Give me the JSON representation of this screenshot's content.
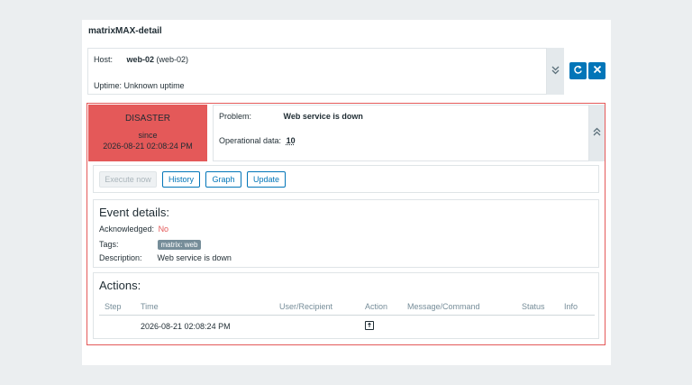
{
  "header": {
    "title": "matrixMAX-detail"
  },
  "host": {
    "host_label": "Host:",
    "host_name": "web-02",
    "host_visible": "(web-02)",
    "uptime_label": "Uptime:",
    "uptime_value": "Unknown uptime"
  },
  "icons": {
    "collapse": "double-chevron-down-icon",
    "expand": "double-chevron-up-icon",
    "refresh": "refresh-icon",
    "close": "close-icon",
    "action": "message-icon"
  },
  "severity": {
    "name": "DISASTER",
    "since_label": "since",
    "since_time": "2026-08-21 02:08:24 PM",
    "color": "#e45959"
  },
  "problem": {
    "problem_label": "Problem:",
    "problem_value": "Web service is down",
    "opdata_label": "Operational data:",
    "opdata_value": "10"
  },
  "buttons": {
    "execute": "Execute now",
    "history": "History",
    "graph": "Graph",
    "update": "Update"
  },
  "event": {
    "heading": "Event details:",
    "ack_label": "Acknowledged:",
    "ack_value": "No",
    "tags_label": "Tags:",
    "tag": "matrix: web",
    "desc_label": "Description:",
    "desc_value": "Web service is down"
  },
  "actions": {
    "heading": "Actions:",
    "columns": [
      "Step",
      "Time",
      "User/Recipient",
      "Action",
      "Message/Command",
      "Status",
      "Info"
    ],
    "rows": [
      {
        "step": "",
        "time": "2026-08-21 02:08:24 PM",
        "user": "",
        "message": "",
        "status": "",
        "info": ""
      }
    ]
  },
  "colors": {
    "accent": "#0275b8",
    "disaster": "#e45959",
    "tag_bg": "#768d99"
  }
}
